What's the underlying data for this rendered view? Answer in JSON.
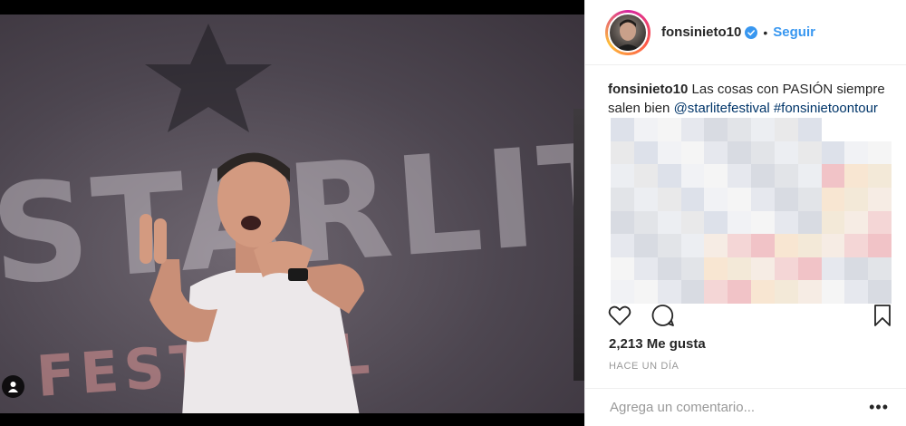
{
  "post": {
    "username": "fonsinieto10",
    "follow_label": "Seguir",
    "separator": "•",
    "caption_user": "fonsinieto10",
    "caption_text": " Las cosas con PASIÓN siempre salen bien ",
    "caption_mention": "@starlitefestival",
    "caption_hashtag": "#fonsinietoontour",
    "likes": "2,213 Me gusta",
    "time_ago": "HACE UN DÍA"
  },
  "photo": {
    "banner_text": "STARLITE",
    "banner_sub": "FESTIVAL"
  },
  "comment": {
    "placeholder": "Agrega un comentario...",
    "more_label": "•••"
  },
  "icons": {
    "like": "heart-icon",
    "comment": "comment-bubble-icon",
    "save": "bookmark-icon",
    "verified": "verified-badge-icon",
    "user_tag": "user-tag-icon"
  },
  "colors": {
    "accent": "#3897f0",
    "hashtag": "#003569",
    "muted": "#999999"
  }
}
